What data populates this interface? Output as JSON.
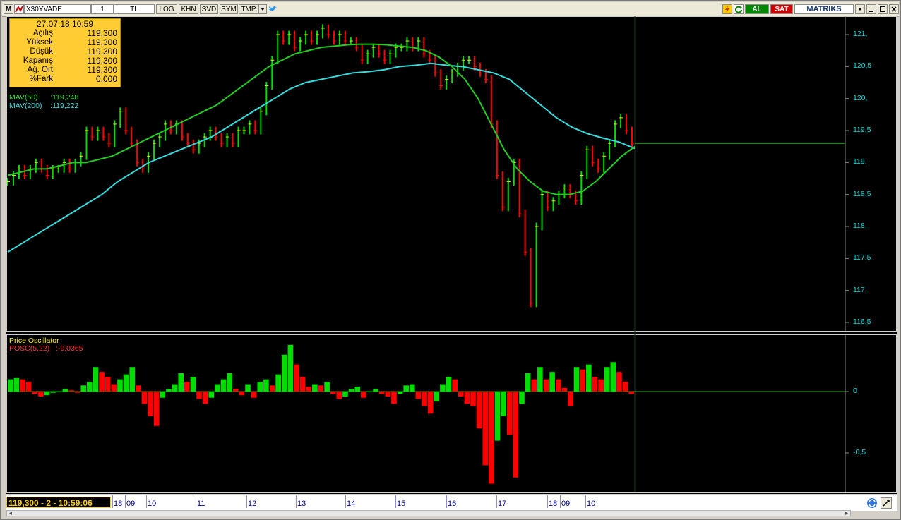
{
  "toolbar": {
    "symbol": "X30YVADE",
    "period": "1",
    "currency": "TL",
    "buttons": [
      "LOG",
      "KHN",
      "SVD",
      "SYM",
      "TMP"
    ],
    "buy_label": "AL",
    "sell_label": "SAT",
    "brand": "MATRIKS",
    "colors": {
      "buy": "#008800",
      "sell": "#cc0000"
    }
  },
  "info_box": {
    "datetime": "27.07.18 10:59",
    "rows": [
      {
        "label": "Açılış",
        "value": "119,300"
      },
      {
        "label": "Yüksek",
        "value": "119,300"
      },
      {
        "label": "Düşük",
        "value": "119,300"
      },
      {
        "label": "Kapanış",
        "value": "119,300"
      },
      {
        "label": "Ağ. Ort",
        "value": "119,300"
      },
      {
        "label": "%Fark",
        "value": "0,000"
      }
    ]
  },
  "mav50": {
    "label": "MAV(50)",
    "value": ":119,248"
  },
  "mav200": {
    "label": "MAV(200)",
    "value": ":119,222"
  },
  "oscillator": {
    "title": "Price Oscillator",
    "label": "POSC(5,22)",
    "value": ":-0,0365"
  },
  "status": "119,300 - 2 - 10:59:06",
  "chart_data": [
    {
      "type": "line",
      "ylim": [
        116.4,
        121.3
      ],
      "yticks": [
        "121,",
        "120,5",
        "120,",
        "119,5",
        "119,",
        "118,5",
        "118,",
        "117,5",
        "117,",
        "116,5"
      ],
      "ytick_values": [
        121,
        120.5,
        120,
        119.5,
        119,
        118.5,
        118,
        117.5,
        117,
        116.5
      ],
      "x_labels": [
        "18",
        "09",
        "10",
        "11",
        "12",
        "13",
        "14",
        "15",
        "16",
        "17",
        "18",
        "09",
        "10"
      ],
      "last_price": 119.3,
      "colors": {
        "up": "#00dd00",
        "down": "#ff0000",
        "mav50": "#22cc22",
        "mav200": "#33dddd"
      },
      "series": [
        {
          "name": "Price",
          "values": [
            118.7,
            118.8,
            118.9,
            118.8,
            118.9,
            119.0,
            118.9,
            118.8,
            118.9,
            118.9,
            119.0,
            118.9,
            119.0,
            119.1,
            119.5,
            119.4,
            119.5,
            119.4,
            119.3,
            119.6,
            119.8,
            119.5,
            119.3,
            119.0,
            118.9,
            119.1,
            119.3,
            119.4,
            119.6,
            119.5,
            119.6,
            119.4,
            119.3,
            119.2,
            119.3,
            119.4,
            119.5,
            119.4,
            119.3,
            119.4,
            119.3,
            119.5,
            119.5,
            119.6,
            119.5,
            119.8,
            120.2,
            120.6,
            121.0,
            120.9,
            121.0,
            120.8,
            120.9,
            121.0,
            120.9,
            121.0,
            121.1,
            121.0,
            120.9,
            121.0,
            120.9,
            120.9,
            120.8,
            120.6,
            120.7,
            120.8,
            120.7,
            120.6,
            120.7,
            120.8,
            120.8,
            120.9,
            120.8,
            120.9,
            120.7,
            120.6,
            120.4,
            120.2,
            120.3,
            120.4,
            120.5,
            120.6,
            120.6,
            120.5,
            120.4,
            120.3,
            119.6,
            118.8,
            118.3,
            118.7,
            119.0,
            118.2,
            117.6,
            116.8,
            118.0,
            118.5,
            118.3,
            118.4,
            118.5,
            118.6,
            118.5,
            118.4,
            118.8,
            119.2,
            119.0,
            118.9,
            119.1,
            119.3,
            119.6,
            119.7,
            119.5,
            119.3
          ]
        },
        {
          "name": "MAV(50)",
          "values": [
            118.8,
            118.85,
            118.9,
            118.9,
            118.95,
            119.0,
            119.0,
            119.05,
            119.1,
            119.2,
            119.3,
            119.4,
            119.5,
            119.6,
            119.7,
            119.8,
            119.9,
            120.05,
            120.2,
            120.35,
            120.5,
            120.6,
            120.7,
            120.75,
            120.8,
            120.82,
            120.84,
            120.85,
            120.85,
            120.84,
            120.82,
            120.8,
            120.75,
            120.65,
            120.5,
            120.3,
            120.0,
            119.6,
            119.2,
            118.9,
            118.7,
            118.55,
            118.5,
            118.5,
            118.55,
            118.7,
            118.9,
            119.1,
            119.25
          ]
        },
        {
          "name": "MAV(200)",
          "values": [
            117.6,
            117.75,
            117.9,
            118.05,
            118.2,
            118.35,
            118.5,
            118.7,
            118.85,
            119.0,
            119.1,
            119.2,
            119.3,
            119.4,
            119.55,
            119.7,
            119.85,
            120.0,
            120.15,
            120.25,
            120.3,
            120.35,
            120.4,
            120.42,
            120.45,
            120.5,
            120.52,
            120.55,
            120.52,
            120.5,
            120.45,
            120.4,
            120.3,
            120.1,
            119.9,
            119.7,
            119.55,
            119.45,
            119.38,
            119.32,
            119.22
          ]
        }
      ]
    },
    {
      "type": "bar",
      "title": "Price Oscillator",
      "ylim": [
        -0.8,
        0.4
      ],
      "yticks": [
        "0",
        "-0,5"
      ],
      "ytick_values": [
        0,
        -0.5
      ],
      "series": [
        {
          "name": "POSC(5,22)",
          "values": [
            0.1,
            0.11,
            0.1,
            0.08,
            -0.02,
            -0.04,
            -0.03,
            -0.01,
            0.0,
            0.02,
            0.01,
            -0.01,
            0.05,
            0.08,
            0.2,
            0.16,
            0.12,
            0.06,
            0.1,
            0.14,
            0.2,
            0.05,
            -0.1,
            -0.2,
            -0.28,
            -0.05,
            0.02,
            0.06,
            0.15,
            0.08,
            0.12,
            -0.06,
            -0.1,
            -0.05,
            0.06,
            0.1,
            0.15,
            0.02,
            -0.03,
            0.06,
            -0.05,
            0.08,
            0.1,
            0.05,
            0.14,
            0.3,
            0.38,
            0.22,
            0.12,
            0.04,
            0.06,
            0.05,
            0.08,
            -0.02,
            -0.06,
            -0.04,
            0.02,
            0.04,
            -0.05,
            0.0,
            0.02,
            -0.02,
            -0.04,
            -0.1,
            -0.02,
            0.05,
            0.06,
            -0.06,
            -0.12,
            -0.18,
            -0.08,
            0.06,
            0.12,
            0.1,
            -0.04,
            -0.1,
            -0.12,
            -0.3,
            -0.6,
            -0.75,
            -0.4,
            -0.2,
            -0.35,
            -0.7,
            -0.1,
            0.15,
            0.1,
            0.2,
            0.1,
            0.16,
            0.1,
            0.03,
            -0.12,
            0.2,
            0.18,
            0.22,
            0.12,
            0.1,
            0.2,
            0.24,
            0.16,
            0.08,
            -0.02
          ]
        }
      ]
    }
  ]
}
